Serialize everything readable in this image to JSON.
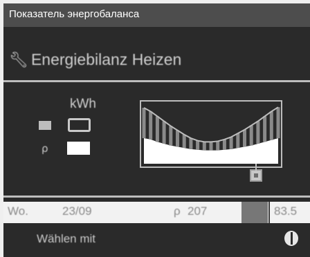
{
  "window": {
    "title": "Показатель энергобаланса"
  },
  "menu": {
    "title": "Energiebilanz Heizen",
    "title_icon": "wrench-icon"
  },
  "legend": {
    "unit": "kWh",
    "items": [
      {
        "swatch_icon": "grey-square-icon",
        "box": "outlined"
      },
      {
        "swatch_icon": "marker-icon",
        "box": "filled-white"
      }
    ]
  },
  "chart_data": {
    "type": "area",
    "series": [
      {
        "values": [
          0.92,
          0.86,
          0.78,
          0.7,
          0.62,
          0.55,
          0.48,
          0.42,
          0.38,
          0.36,
          0.36,
          0.37,
          0.4,
          0.44,
          0.5,
          0.56,
          0.63,
          0.7,
          0.78,
          0.86,
          0.93
        ]
      },
      {
        "values": [
          0.42,
          0.4,
          0.36,
          0.33,
          0.3,
          0.28,
          0.26,
          0.24,
          0.23,
          0.22,
          0.22,
          0.22,
          0.23,
          0.24,
          0.26,
          0.28,
          0.3,
          0.33,
          0.36,
          0.39,
          0.42
        ]
      }
    ],
    "cursor_index": 16,
    "colors": {
      "fill": "#ffffff",
      "bars": "#8a8a8a",
      "border": "#bdbdbd"
    }
  },
  "status": {
    "day": "Wo.",
    "date": "23/09",
    "value_mark": "ρ",
    "value": "207",
    "last": "83.5"
  },
  "footer": {
    "hint": "Wählen mit",
    "knob_icon": "rotary-knob-icon"
  }
}
